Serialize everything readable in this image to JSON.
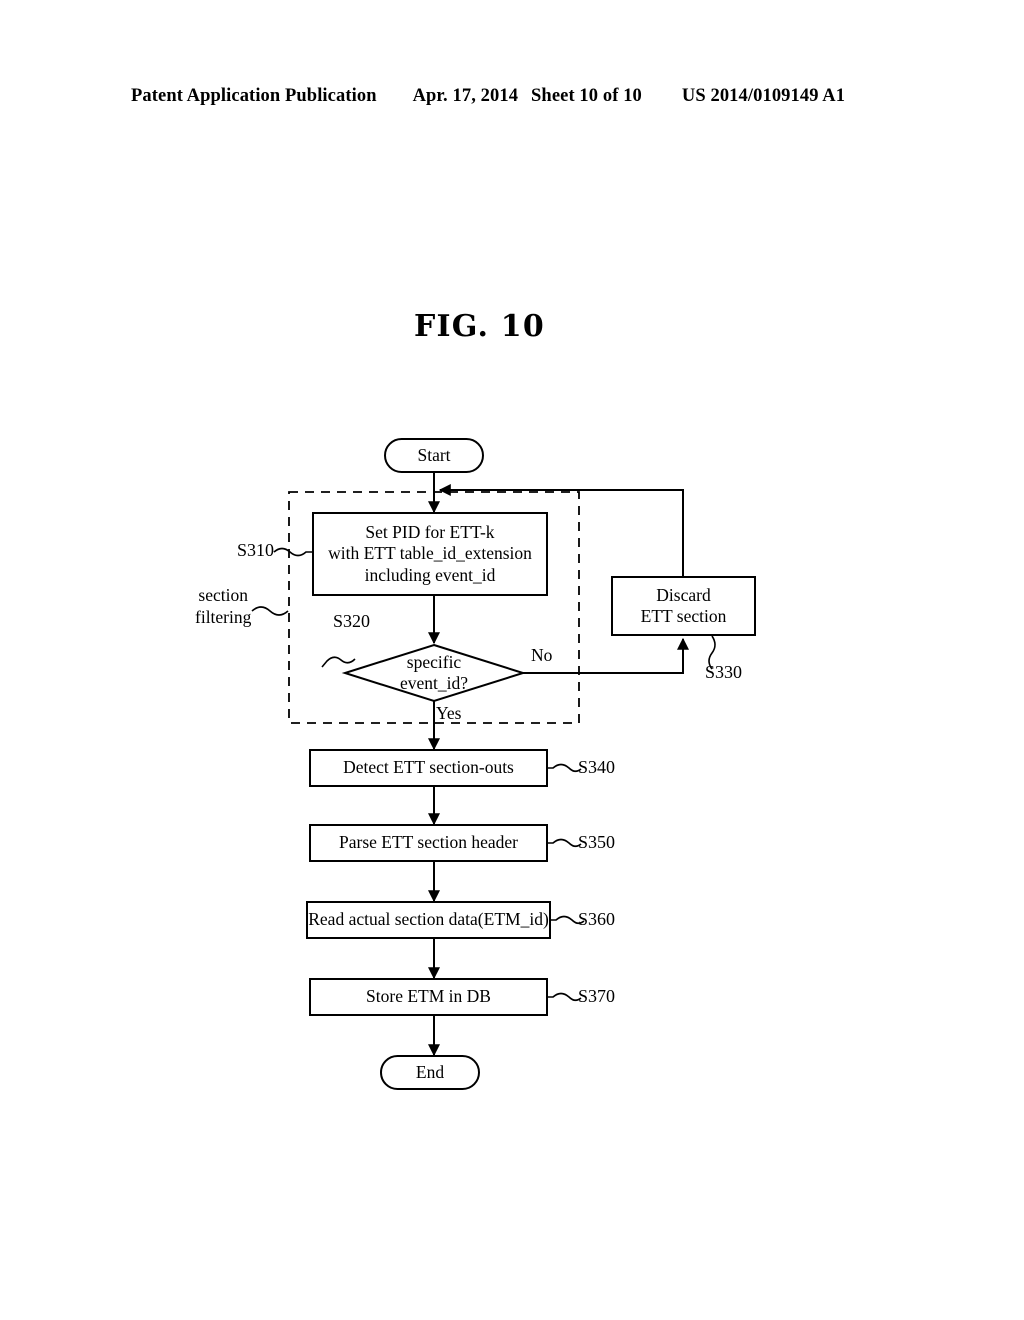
{
  "header": {
    "publication": "Patent Application Publication",
    "date": "Apr. 17, 2014",
    "sheet": "Sheet 10 of 10",
    "patent_number": "US 2014/0109149 A1"
  },
  "figure": {
    "title": "FIG. 10",
    "group_label": "section\nfiltering",
    "group_label_line1": "section",
    "group_label_line2": "filtering",
    "nodes": {
      "start": {
        "label": "Start",
        "shape": "terminator"
      },
      "set_pid": {
        "line1": "Set PID for ETT-k",
        "line2": "with ETT table_id_extension",
        "line3": "including event_id",
        "step": "S310",
        "shape": "process"
      },
      "decision": {
        "line1": "specific",
        "line2": "event_id?",
        "step": "S320",
        "shape": "decision",
        "yes_label": "Yes",
        "no_label": "No"
      },
      "discard": {
        "line1": "Discard",
        "line2": "ETT section",
        "step": "S330",
        "shape": "process"
      },
      "detect": {
        "label": "Detect ETT section-outs",
        "step": "S340",
        "shape": "process"
      },
      "parse": {
        "label": "Parse ETT section header",
        "step": "S350",
        "shape": "process"
      },
      "read": {
        "label": "Read actual section data(ETM_id)",
        "step": "S360",
        "shape": "process"
      },
      "store": {
        "label": "Store ETM in DB",
        "step": "S370",
        "shape": "process"
      },
      "end": {
        "label": "End",
        "shape": "terminator"
      }
    }
  },
  "colors": {
    "ink": "#000000",
    "paper": "#ffffff"
  }
}
